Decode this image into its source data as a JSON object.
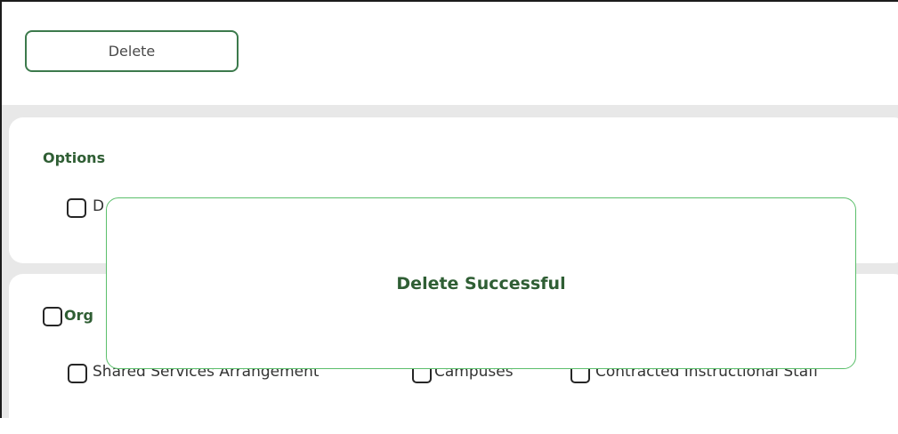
{
  "toolbar": {
    "delete_label": "Delete"
  },
  "options": {
    "title": "Options",
    "items": [
      {
        "label": "D"
      }
    ]
  },
  "organization": {
    "title": "Org",
    "items": [
      {
        "label": "Shared Services Arrangement"
      },
      {
        "label": "Campuses"
      },
      {
        "label": "Contracted Instructional Staff"
      }
    ]
  },
  "modal": {
    "message": "Delete Successful"
  },
  "colors": {
    "accent_green": "#3c7a4c",
    "modal_border": "#5bbf6b",
    "title_green": "#2f5e34"
  }
}
